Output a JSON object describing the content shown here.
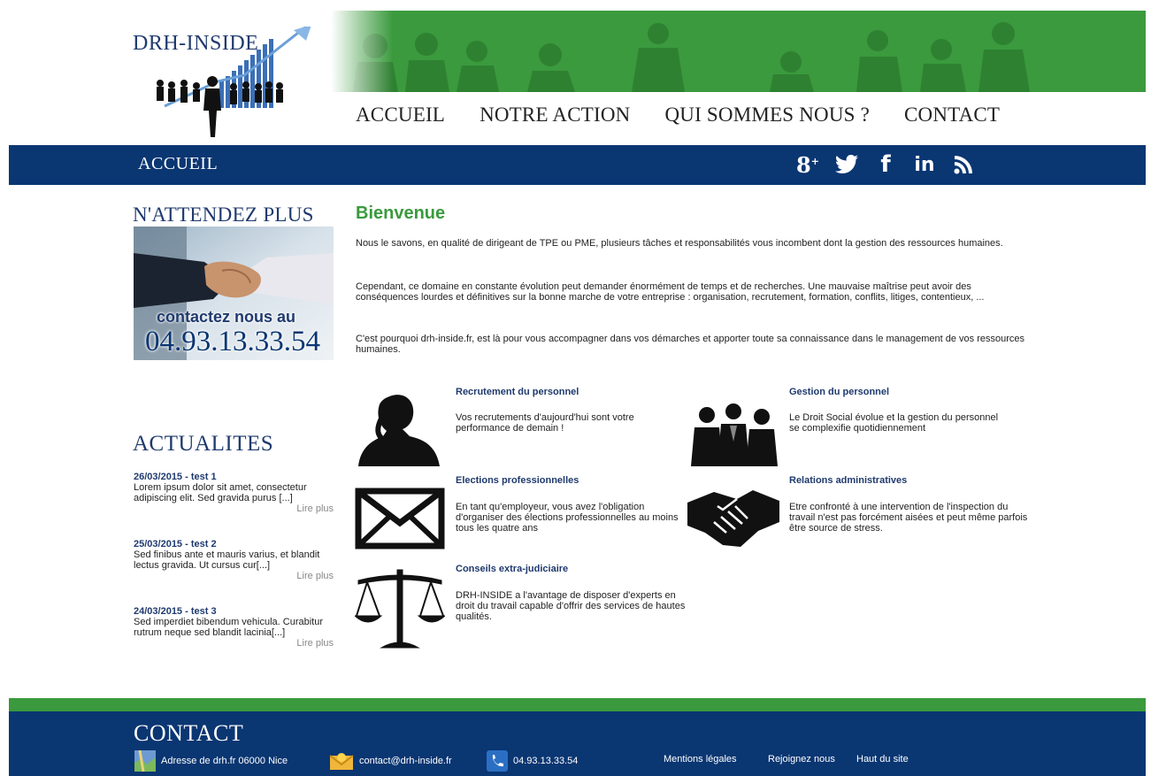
{
  "header": {
    "logo_text": "DRH-INSIDE",
    "nav": [
      "ACCUEIL",
      "NOTRE ACTION",
      "QUI SOMMES NOUS ?",
      "CONTACT"
    ]
  },
  "bar": {
    "title": "ACCUEIL",
    "social": [
      "google-plus-icon",
      "twitter-icon",
      "facebook-icon",
      "linkedin-icon",
      "rss-icon"
    ]
  },
  "sidebar": {
    "heading": "N'ATTENDEZ PLUS",
    "promo_text": "contactez nous au",
    "promo_phone": "04.93.13.33.54",
    "news_heading": "ACTUALITES",
    "news": [
      {
        "title": "26/03/2015 - test 1",
        "text": "Lorem ipsum dolor sit amet, consectetur adipiscing elit. Sed gravida purus [...]",
        "more": "Lire plus"
      },
      {
        "title": "25/03/2015 - test 2",
        "text": "Sed finibus ante et mauris varius, et blandit lectus gravida. Ut cursus cur[...]",
        "more": "Lire plus"
      },
      {
        "title": "24/03/2015 - test 3",
        "text": "Sed imperdiet bibendum vehicula. Curabitur rutrum neque sed blandit lacinia[...]",
        "more": "Lire plus"
      }
    ]
  },
  "main": {
    "title": "Bienvenue",
    "paragraphs": [
      "Nous le savons, en qualité de dirigeant de TPE ou PME, plusieurs tâches et responsabilités vous incombent dont la gestion des ressources humaines.",
      "Cependant, ce domaine en constante évolution peut demander énormément de temps et de recherches. Une mauvaise maîtrise peut avoir des conséquences lourdes et définitives sur la bonne marche de votre entreprise : organisation, recrutement, formation, conflits, litiges, contentieux, ...",
      "C'est pourquoi drh-inside.fr, est là pour vous accompagner dans vos démarches et apporter toute sa connaissance dans le management de vos ressources humaines."
    ],
    "services": [
      {
        "title": "Recrutement du  personnel",
        "text": "Vos recrutements d'aujourd'hui sont votre performance de demain !",
        "icon": "silhouette-woman-icon"
      },
      {
        "title": "Gestion du personnel",
        "text": "Le Droit Social évolue et la gestion du personnel se complexifie quotidiennement",
        "icon": "group-people-icon"
      },
      {
        "title": "Elections professionnelles",
        "text": "En tant qu'employeur, vous avez l'obligation d'organiser des élections professionnelles au moins tous les quatre ans",
        "icon": "envelope-icon"
      },
      {
        "title": "Relations administratives",
        "text": "Etre confronté à une intervention de l'inspection du travail n'est pas forcément aisées et peut même parfois être source de stress.",
        "icon": "handshake-icon"
      },
      {
        "title": "Conseils extra-judiciaire",
        "text": "DRH-INSIDE a l'avantage de disposer d'experts en droit du travail capable d'offrir des services de hautes qualités.",
        "icon": "scales-icon"
      }
    ]
  },
  "footer": {
    "title": "CONTACT",
    "address": "Adresse de drh.fr 06000 Nice",
    "email": "contact@drh-inside.fr",
    "phone": "04.93.13.33.54",
    "links": [
      "Mentions légales",
      "Rejoignez nous",
      "Haut du site"
    ]
  },
  "colors": {
    "green": "#3a9a3d",
    "navy": "#0a3672",
    "title_blue": "#1f3a6e"
  }
}
